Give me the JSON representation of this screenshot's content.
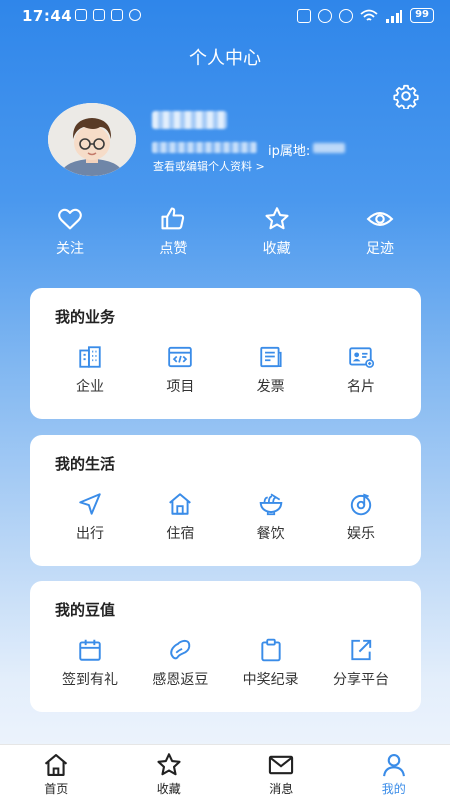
{
  "status_bar": {
    "time": "17:44",
    "battery": "99"
  },
  "header": {
    "title": "个人中心"
  },
  "profile": {
    "ip_label": "ip属地:",
    "edit_link": "查看或编辑个人资料 >"
  },
  "quick_actions": [
    {
      "label": "关注",
      "icon": "heart-icon"
    },
    {
      "label": "点赞",
      "icon": "thumbs-up-icon"
    },
    {
      "label": "收藏",
      "icon": "star-icon"
    },
    {
      "label": "足迹",
      "icon": "eye-icon"
    }
  ],
  "sections": {
    "business": {
      "title": "我的业务",
      "items": [
        {
          "label": "企业",
          "icon": "building-icon"
        },
        {
          "label": "项目",
          "icon": "code-window-icon"
        },
        {
          "label": "发票",
          "icon": "invoice-icon"
        },
        {
          "label": "名片",
          "icon": "business-card-icon"
        }
      ]
    },
    "life": {
      "title": "我的生活",
      "items": [
        {
          "label": "出行",
          "icon": "navigation-icon"
        },
        {
          "label": "住宿",
          "icon": "house-icon"
        },
        {
          "label": "餐饮",
          "icon": "noodle-bowl-icon"
        },
        {
          "label": "娱乐",
          "icon": "music-disc-icon"
        }
      ]
    },
    "beans": {
      "title": "我的豆值",
      "items": [
        {
          "label": "签到有礼",
          "icon": "calendar-icon"
        },
        {
          "label": "感恩返豆",
          "icon": "bean-icon"
        },
        {
          "label": "中奖纪录",
          "icon": "clipboard-icon"
        },
        {
          "label": "分享平台",
          "icon": "share-icon"
        }
      ]
    }
  },
  "tabbar": [
    {
      "label": "首页",
      "icon": "home-icon"
    },
    {
      "label": "收藏",
      "icon": "star-icon"
    },
    {
      "label": "消息",
      "icon": "mail-icon"
    },
    {
      "label": "我的",
      "icon": "user-icon",
      "active": true
    }
  ],
  "colors": {
    "accent": "#3a8ce8",
    "header_top": "#2f86ea",
    "card_bg": "#ffffff"
  }
}
